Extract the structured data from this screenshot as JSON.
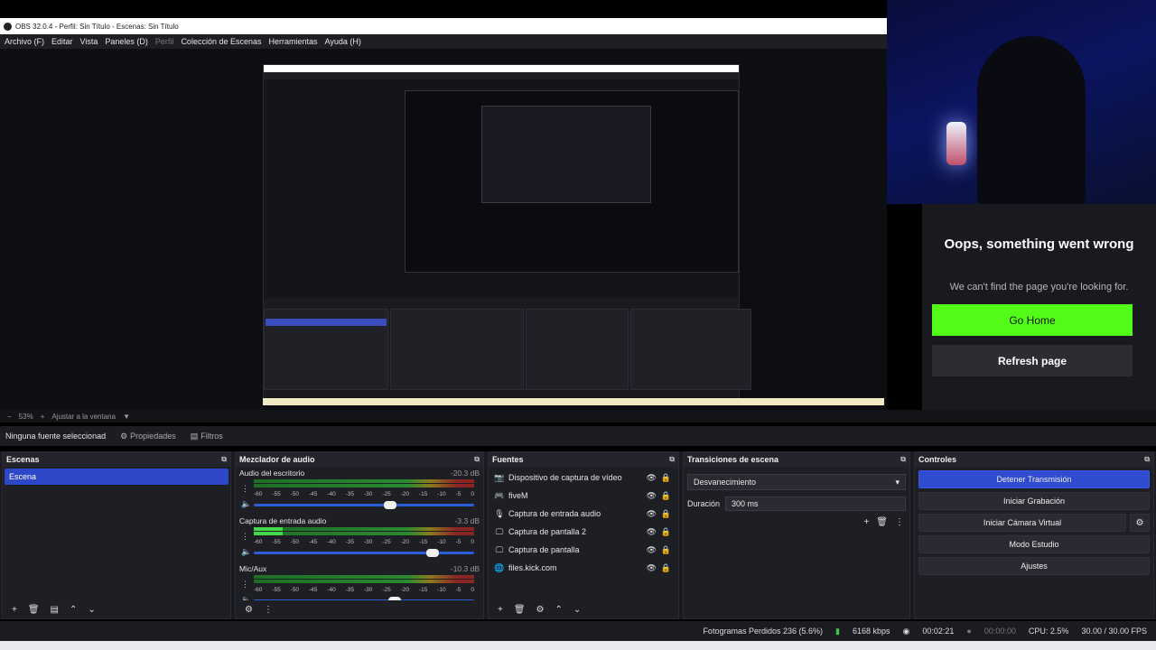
{
  "window": {
    "title": "OBS 32.0.4 - Perfil: Sin Título - Escenas: Sin Título"
  },
  "menu": [
    {
      "label": "Archivo (F)",
      "disabled": false
    },
    {
      "label": "Editar",
      "disabled": false
    },
    {
      "label": "Vista",
      "disabled": false
    },
    {
      "label": "Paneles (D)",
      "disabled": false
    },
    {
      "label": "Perfil",
      "disabled": true
    },
    {
      "label": "Colección de Escenas",
      "disabled": false
    },
    {
      "label": "Herramientas",
      "disabled": false
    },
    {
      "label": "Ayuda (H)",
      "disabled": false
    }
  ],
  "preview": {
    "error_title": "Oops, something went wrong",
    "error_subtitle": "We can't find the page you're looking for.",
    "go_home": "Go Home",
    "refresh": "Refresh page"
  },
  "zoom": {
    "percent": "53%",
    "fit": "Ajustar a la ventana"
  },
  "source_bar": {
    "no_source": "Ninguna fuente seleccionad",
    "properties": "Propiedades",
    "filters": "Filtros"
  },
  "scenes": {
    "title": "Escenas",
    "items": [
      "Escena"
    ]
  },
  "mixer": {
    "title": "Mezclador de audio",
    "ticks": [
      "-60",
      "-55",
      "-50",
      "-45",
      "-40",
      "-35",
      "-30",
      "-25",
      "-20",
      "-15",
      "-10",
      "-5",
      "0"
    ],
    "channels": [
      {
        "name": "Audio del escritorio",
        "db": "-20.3 dB",
        "level": 0.0,
        "fader": 0.62
      },
      {
        "name": "Captura de entrada audio",
        "db": "-3.3 dB",
        "level": 0.13,
        "fader": 0.81
      },
      {
        "name": "Mic/Aux",
        "db": "-10.3 dB",
        "level": 0.0,
        "fader": 0.64
      }
    ]
  },
  "sources": {
    "title": "Fuentes",
    "items": [
      {
        "name": "Dispositivo de captura de vídeo",
        "icon": "camera-icon",
        "locked": false
      },
      {
        "name": "fiveM",
        "icon": "gamepad-icon",
        "locked": false
      },
      {
        "name": "Captura de entrada audio",
        "icon": "mic-icon",
        "locked": false
      },
      {
        "name": "Captura de pantalla 2",
        "icon": "monitor-icon",
        "locked": true
      },
      {
        "name": "Captura de pantalla",
        "icon": "monitor-icon",
        "locked": true
      },
      {
        "name": "files.kick.com",
        "icon": "globe-icon",
        "locked": true
      }
    ]
  },
  "transitions": {
    "title": "Transiciones de escena",
    "selected": "Desvanecimiento",
    "duration_label": "Duración",
    "duration_value": "300 ms"
  },
  "controls": {
    "title": "Controles",
    "stop_stream": "Detener Transmisión",
    "start_recording": "Iniciar Grabación",
    "start_virtual_cam": "Iniciar Cámara Virtual",
    "studio_mode": "Modo Estudio",
    "settings": "Ajustes"
  },
  "status": {
    "dropped": "Fotogramas Perdidos 236 (5.6%)",
    "bitrate": "6168 kbps",
    "stream_time": "00:02:21",
    "rec_time": "00:00:00",
    "cpu": "CPU: 2.5%",
    "fps": "30.00 / 30.00 FPS"
  },
  "colors": {
    "accent": "#2f4bd0",
    "kick_green": "#53fc18"
  }
}
